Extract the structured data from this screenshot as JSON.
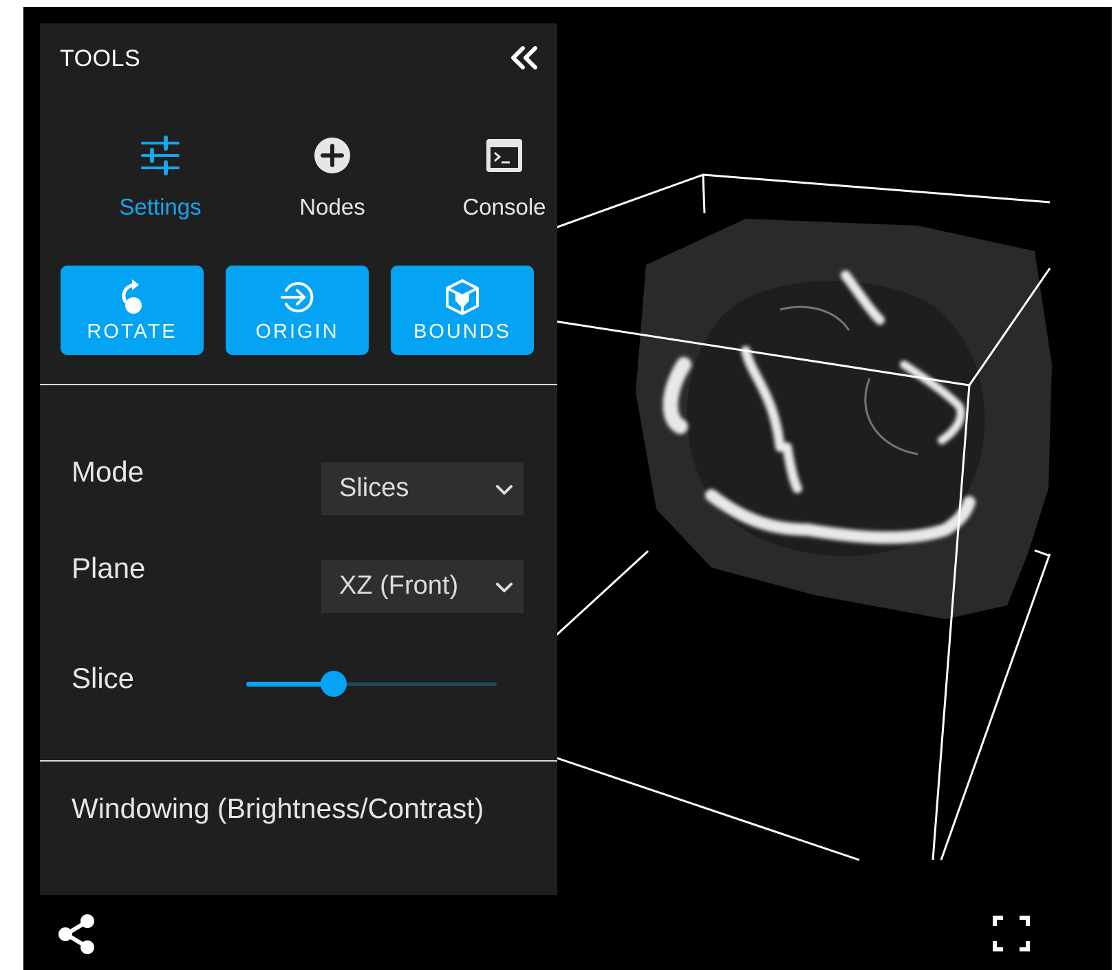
{
  "panel": {
    "title": "TOOLS",
    "collapse_icon": "double-chevron-left-icon"
  },
  "tabs": [
    {
      "label": "Settings",
      "icon": "sliders-icon",
      "active": true
    },
    {
      "label": "Nodes",
      "icon": "plus-circle-icon",
      "active": false
    },
    {
      "label": "Console",
      "icon": "terminal-icon",
      "active": false
    }
  ],
  "actions": [
    {
      "label": "ROTATE",
      "icon": "rotate-icon"
    },
    {
      "label": "ORIGIN",
      "icon": "origin-icon"
    },
    {
      "label": "BOUNDS",
      "icon": "cube-icon"
    }
  ],
  "settings": {
    "mode_label": "Mode",
    "mode_value": "Slices",
    "plane_label": "Plane",
    "plane_value": "XZ (Front)",
    "slice_label": "Slice",
    "slice_level": 0.35
  },
  "windowing_label": "Windowing (Brightness/Contrast)",
  "footer": {
    "share_icon": "share-icon",
    "fullscreen_icon": "fullscreen-icon"
  },
  "colors": {
    "accent": "#05a3f3",
    "panel_bg": "#1f1f1f",
    "viewer_bg": "#000000"
  }
}
